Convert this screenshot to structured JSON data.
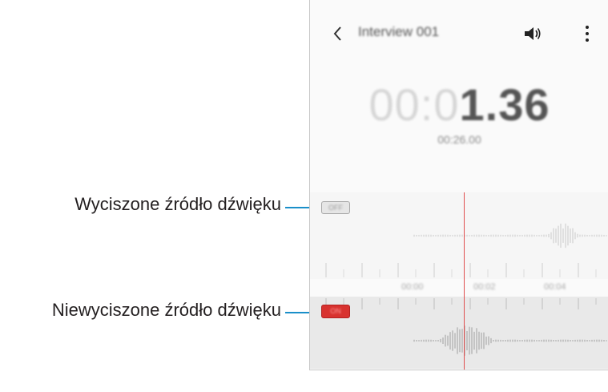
{
  "callouts": {
    "muted_source": "Wyciszone źródło dźwięku",
    "unmuted_source": "Niewyciszone źródło dźwięku"
  },
  "header": {
    "title": "Interview 001",
    "back_icon": "chevron-left-icon",
    "volume_icon": "speaker-icon",
    "more_icon": "more-vertical-icon"
  },
  "timer": {
    "dim_part": "00:0",
    "bright_part": "1.36",
    "total_duration": "00:26.00"
  },
  "timeline": {
    "labels": [
      "00:00",
      "00:02",
      "00:04"
    ]
  },
  "tracks": {
    "muted_label": "OFF",
    "active_label": "ON"
  },
  "colors": {
    "leader_line": "#1a8fc9",
    "playhead": "#e05050",
    "active_badge": "#d8322f"
  }
}
